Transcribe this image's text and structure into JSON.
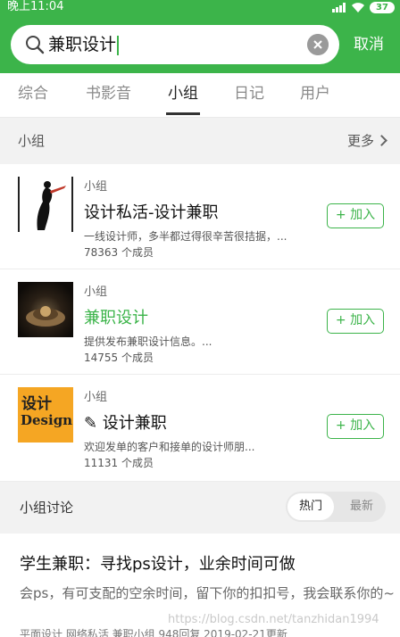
{
  "status_bar": {
    "time": "晚上11:04",
    "battery": "37"
  },
  "search": {
    "query": "兼职设计",
    "cancel_label": "取消"
  },
  "tabs": [
    {
      "label": "综合"
    },
    {
      "label": "书影音"
    },
    {
      "label": "小组"
    },
    {
      "label": "日记"
    },
    {
      "label": "用户"
    }
  ],
  "active_tab": "小组",
  "groups_section": {
    "title": "小组",
    "more_label": "更多"
  },
  "groups": [
    {
      "type": "小组",
      "title": "设计私活-设计兼职",
      "description": "一线设计师，多半都过得很辛苦很拮据，...",
      "members": "78363 个成员",
      "join_label": "+ 加入"
    },
    {
      "type": "小组",
      "title": "兼职设计",
      "description": "提供发布兼职设计信息。...",
      "members": "14755 个成员",
      "join_label": "+ 加入"
    },
    {
      "type": "小组",
      "title": "✎ 设计兼职",
      "description": "欢迎发单的客户和接单的设计师朋...",
      "members": "11131 个成员",
      "join_label": "+ 加入",
      "thumb_text_1": "设计",
      "thumb_text_2": "Design"
    }
  ],
  "discussion": {
    "title": "小组讨论",
    "sort_hot": "热门",
    "sort_new": "最新",
    "post": {
      "title": "学生兼职：寻找ps设计，业余时间可做",
      "body": "会ps，有可支配的空余时间，留下你的扣扣号，我会联系你的~",
      "meta": "平面设计 网络私活 兼职小组 948回复 2019-02-21更新"
    }
  },
  "watermark": "https://blog.csdn.net/tanzhidan1994",
  "colors": {
    "accent": "#3cb44a"
  }
}
